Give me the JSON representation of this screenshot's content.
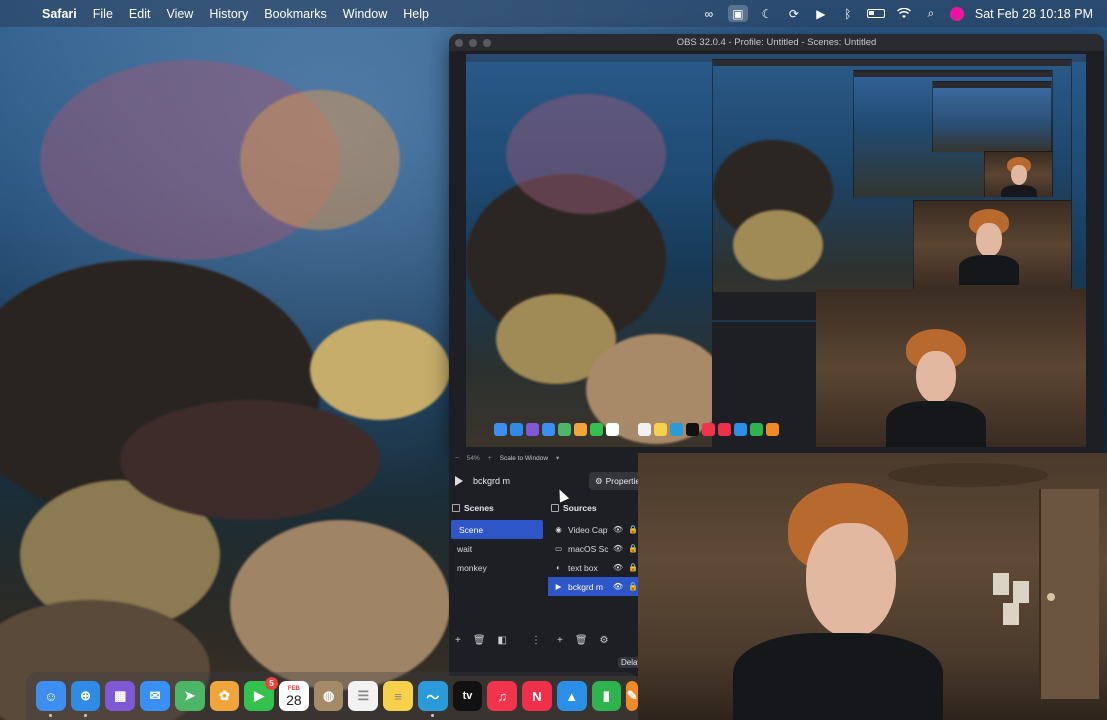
{
  "menubar": {
    "app_name": "Safari",
    "menus": [
      "File",
      "Edit",
      "View",
      "History",
      "Bookmarks",
      "Window",
      "Help"
    ],
    "clock": "Sat Feb 28  10:18 PM",
    "status_icons": [
      "creative-cloud-icon",
      "screen-record-icon",
      "focus-moon-icon",
      "sync-icon",
      "play-circle-icon",
      "bluetooth-icon",
      "battery-icon",
      "wifi-icon",
      "spotlight-search-icon",
      "siri-icon"
    ]
  },
  "obs": {
    "window_title": "OBS 32.0.4 - Profile: Untitled - Scenes: Untitled",
    "zoom": "54%",
    "zoom_mode": "Scale to Window",
    "current_source": "bckgrd m",
    "properties_label": "Properties",
    "scenes_title": "Scenes",
    "sources_title": "Sources",
    "scenes": [
      "Scene",
      "wait",
      "monkey"
    ],
    "selected_scene": "Scene",
    "sources": [
      {
        "label": "Video Capture",
        "icon": "camera-icon"
      },
      {
        "label": "macOS Screen Capture",
        "icon": "monitor-icon"
      },
      {
        "label": "text box",
        "icon": "text-icon"
      },
      {
        "label": "bckgrd m",
        "icon": "play-icon"
      }
    ],
    "selected_source": "bckgrd m",
    "delay_label": "Delay"
  },
  "dock": {
    "apps": [
      {
        "name": "Finder",
        "icon": "finder-icon",
        "color": "#3d8ef0"
      },
      {
        "name": "Safari",
        "icon": "safari-icon",
        "color": "#2f8be6"
      },
      {
        "name": "Launchpad",
        "icon": "launchpad-icon",
        "color": "#7f58d8"
      },
      {
        "name": "Mail",
        "icon": "mail-icon",
        "color": "#3a8ff5"
      },
      {
        "name": "Maps",
        "icon": "maps-icon",
        "color": "#4cb566"
      },
      {
        "name": "Photos",
        "icon": "photos-icon",
        "color": "#f1a43a"
      },
      {
        "name": "FaceTime",
        "icon": "facetime-icon",
        "color": "#33c24d",
        "badge": "5"
      },
      {
        "name": "Calendar",
        "icon": "calendar-icon",
        "month": "FEB",
        "day": "28"
      },
      {
        "name": "Contacts",
        "icon": "contacts-icon",
        "color": "#a58a6a"
      },
      {
        "name": "Reminders",
        "icon": "reminders-icon",
        "color": "#f2f2f2"
      },
      {
        "name": "Notes",
        "icon": "notes-icon",
        "color": "#f6d24a"
      },
      {
        "name": "Freeform",
        "icon": "freeform-icon",
        "color": "#2a9bd8"
      },
      {
        "name": "TV",
        "icon": "tv-icon",
        "color": "#111111",
        "label": "tv"
      },
      {
        "name": "Music",
        "icon": "music-icon",
        "color": "#f2334b"
      },
      {
        "name": "News",
        "icon": "news-icon",
        "color": "#f0304a"
      },
      {
        "name": "Keynote",
        "icon": "keynote-icon",
        "color": "#2b8fe8"
      },
      {
        "name": "Numbers",
        "icon": "numbers-icon",
        "color": "#2fb44d"
      },
      {
        "name": "Pages",
        "icon": "pages-icon",
        "color": "#f08a26"
      }
    ]
  }
}
